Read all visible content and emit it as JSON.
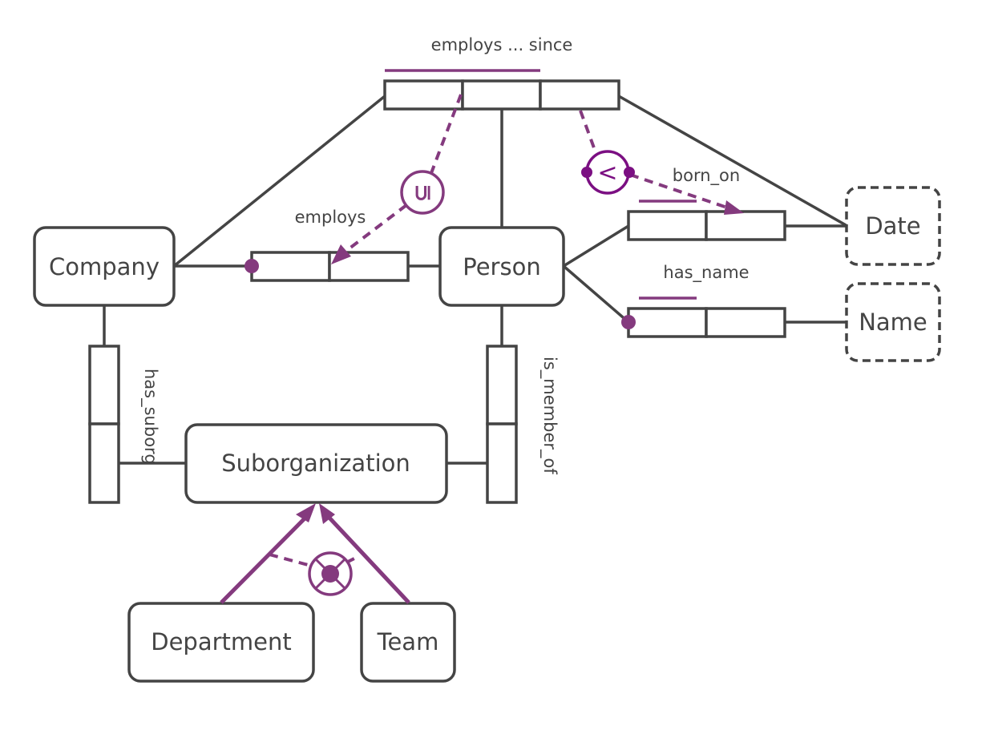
{
  "diagram": {
    "type": "ORM conceptual schema",
    "colors": {
      "stroke": "#444444",
      "accent": "#843a7e",
      "accent_dark": "#7b0f82",
      "background": "#ffffff"
    },
    "entity_types": [
      {
        "id": "company",
        "label": "Company"
      },
      {
        "id": "person",
        "label": "Person"
      },
      {
        "id": "suborganization",
        "label": "Suborganization"
      },
      {
        "id": "department",
        "label": "Department"
      },
      {
        "id": "team",
        "label": "Team"
      }
    ],
    "value_types": [
      {
        "id": "date",
        "label": "Date"
      },
      {
        "id": "name",
        "label": "Name"
      }
    ],
    "fact_types": [
      {
        "id": "employs_since",
        "label": "employs ... since",
        "roles": [
          "Company",
          "Person",
          "Date"
        ],
        "uniqueness": "roles 1-2"
      },
      {
        "id": "employs",
        "label": "employs",
        "roles": [
          "Company",
          "Person"
        ],
        "mandatory": "Company",
        "uniqueness": "none shown"
      },
      {
        "id": "born_on",
        "label": "born_on",
        "roles": [
          "Person",
          "Date"
        ],
        "uniqueness": "role 1"
      },
      {
        "id": "has_name",
        "label": "has_name",
        "roles": [
          "Person",
          "Name"
        ],
        "mandatory": "Person",
        "uniqueness": "role 1"
      },
      {
        "id": "has_suborg",
        "label": "has_suborg",
        "roles": [
          "Company",
          "Suborganization"
        ]
      },
      {
        "id": "is_member_of",
        "label": "is_member_of",
        "roles": [
          "Person",
          "Suborganization"
        ]
      }
    ],
    "constraints": [
      {
        "id": "subset",
        "symbol": "⊆",
        "name": "subset constraint",
        "from": "employs ... since (roles 1-2)",
        "to": "employs"
      },
      {
        "id": "value_comparison",
        "symbol": "<",
        "name": "value comparison constraint",
        "from": "employs ... since (Date role)",
        "to": "born_on (Date role)"
      },
      {
        "id": "exclusive_or",
        "symbol": "⊗",
        "name": "exclusion constraint",
        "between": [
          "Department subtype",
          "Team subtype"
        ]
      }
    ],
    "subtypes": [
      {
        "sub": "Department",
        "super": "Suborganization"
      },
      {
        "sub": "Team",
        "super": "Suborganization"
      }
    ],
    "symbols": {
      "subset": "⊆",
      "less_than": "<"
    }
  }
}
